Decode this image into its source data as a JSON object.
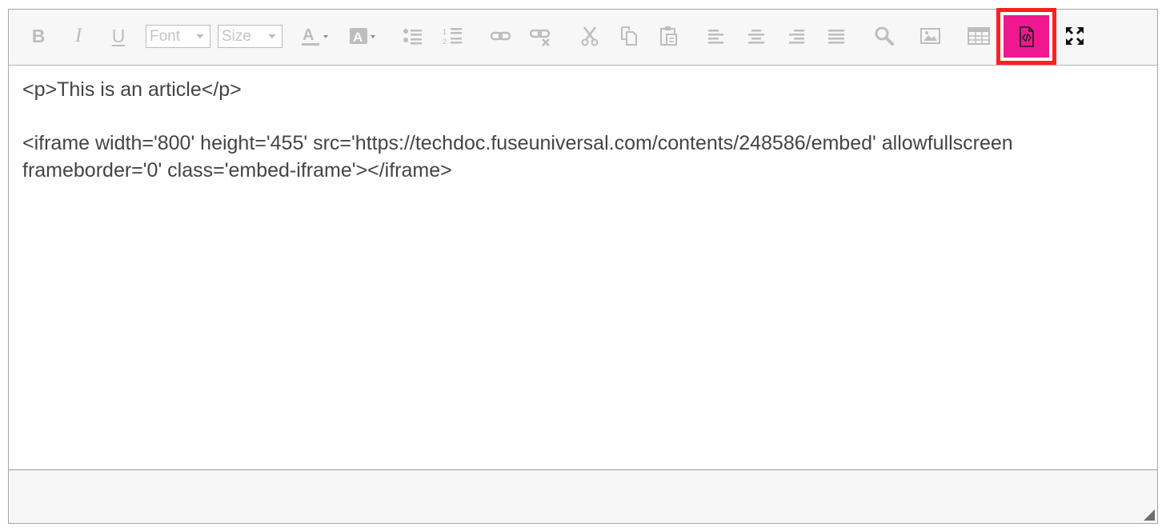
{
  "toolbar": {
    "bold": "B",
    "italic": "I",
    "underline": "U",
    "font_placeholder": "Font",
    "size_placeholder": "Size",
    "highlight_color": "#ef1890",
    "highlight_border_color": "#ff1f1f",
    "buttons": [
      "bold-icon",
      "italic-icon",
      "underline-icon",
      "font-select",
      "size-select",
      "font-color-icon",
      "background-color-icon",
      "bullet-list-icon",
      "numbered-list-icon",
      "link-icon",
      "unlink-icon",
      "cut-icon",
      "copy-icon",
      "paste-icon",
      "align-left-icon",
      "align-center-icon",
      "align-right-icon",
      "justify-icon",
      "search-icon",
      "image-icon",
      "table-icon",
      "source-code-icon",
      "fullscreen-icon"
    ]
  },
  "content": {
    "lines": [
      "<p>This is an article</p>",
      "<iframe width='800' height='455' src='https://techdoc.fuseuniversal.com/contents/248586/embed' allowfullscreen frameborder='0' class='embed-iframe'></iframe>"
    ]
  }
}
